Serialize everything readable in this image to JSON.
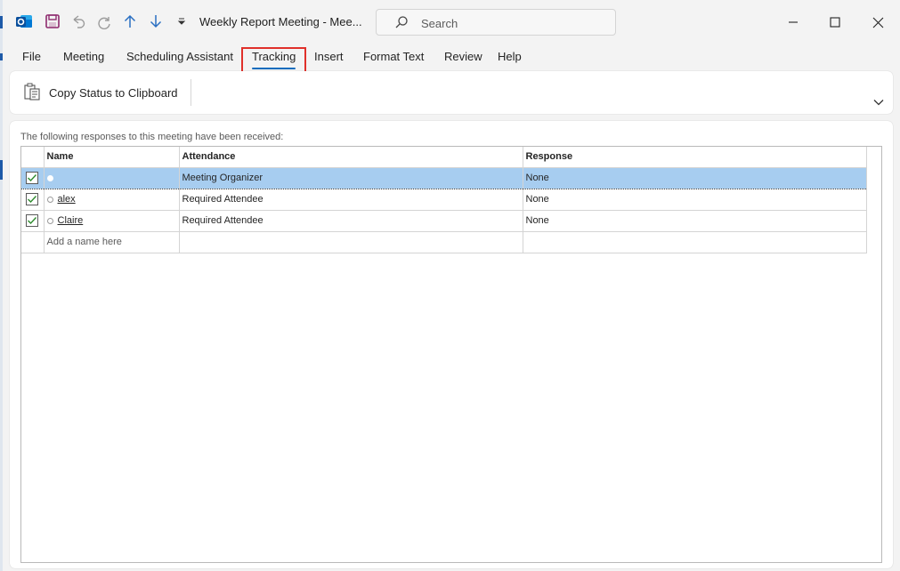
{
  "window": {
    "title": "Weekly Report Meeting  -  Mee...",
    "search_placeholder": "Search"
  },
  "quick_access": [
    "outlook-icon",
    "save-icon",
    "undo-icon",
    "redo-icon",
    "previous-item-icon",
    "next-item-icon",
    "customize-quick-access-icon"
  ],
  "menu": {
    "tabs": [
      {
        "label": "File"
      },
      {
        "label": "Meeting"
      },
      {
        "label": "Scheduling Assistant"
      },
      {
        "label": "Tracking",
        "active": true
      },
      {
        "label": "Insert"
      },
      {
        "label": "Format Text"
      },
      {
        "label": "Review"
      },
      {
        "label": "Help"
      }
    ]
  },
  "ribbon": {
    "copy_status_label": "Copy Status to Clipboard"
  },
  "tracking": {
    "caption": "The following responses to this meeting have been received:",
    "columns": {
      "name": "Name",
      "attendance": "Attendance",
      "response": "Response"
    },
    "rows": [
      {
        "name": "",
        "attendance": "Meeting Organizer",
        "response": "None",
        "checked": true,
        "selected": true
      },
      {
        "name": "alex",
        "attendance": "Required Attendee",
        "response": "None",
        "checked": true,
        "selected": false
      },
      {
        "name": "Claire",
        "attendance": "Required Attendee",
        "response": "None",
        "checked": true,
        "selected": false
      }
    ],
    "add_name_placeholder": "Add a name here"
  },
  "colors": {
    "accent": "#0f6cbd",
    "selected_row": "#a7cdf0",
    "highlight_box": "#e0302a",
    "check_green": "#2e8b2e"
  }
}
